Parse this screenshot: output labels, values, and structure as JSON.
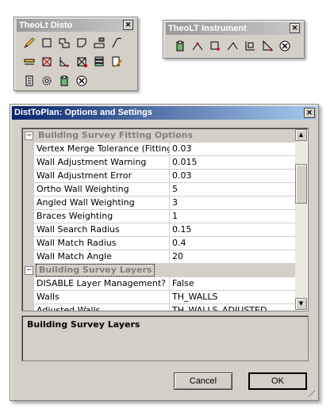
{
  "disto_toolbar": {
    "title": "TheoLt Disto",
    "close_label": "✕",
    "rows": [
      [
        "pencil-icon",
        "rectangle-icon",
        "step-rect-icon",
        "corner-rect-icon",
        "layer-rect-icon",
        "arc-line-icon"
      ],
      [
        "layer-lines-icon",
        "cross-box-icon",
        "measure-tri-icon",
        "cross-box-red-icon",
        "layers-stack-icon",
        "edit-doc-icon"
      ],
      [
        "device-icon",
        "gear-icon",
        "clip-icon",
        "close-circle-icon"
      ]
    ]
  },
  "instrument_toolbar": {
    "title": "TheoLT Instrument",
    "close_label": "✕",
    "icons": [
      "clip-icon",
      "point-arc-icon",
      "box-point-icon",
      "angle-line-icon",
      "corner-measure-icon",
      "triangle-measure-icon",
      "close-circle-icon"
    ]
  },
  "dialog": {
    "title": "DistToPlan: Options and Settings",
    "close_label": "✕",
    "categories": [
      {
        "name": "Building Survey Fitting Options",
        "toggle": "−",
        "rows": [
          {
            "name": "Vertex Merge Tolerance (Fitting)",
            "value": "0.03"
          },
          {
            "name": "Wall Adjustment Warning",
            "value": "0.015"
          },
          {
            "name": "Wall Adjustment Error",
            "value": "0.03"
          },
          {
            "name": "Ortho Wall Weighting",
            "value": "5"
          },
          {
            "name": "Angled Wall Weighting",
            "value": "3"
          },
          {
            "name": "Braces Weighting",
            "value": "1"
          },
          {
            "name": "Wall Search Radius",
            "value": "0.15"
          },
          {
            "name": "Wall Match Radius",
            "value": "0.4"
          },
          {
            "name": "Wall Match Angle",
            "value": "20"
          }
        ]
      },
      {
        "name": "Building Survey Layers",
        "toggle": "−",
        "rows": [
          {
            "name": "DISABLE Layer Management?",
            "value": "False"
          },
          {
            "name": "Walls",
            "value": "TH_WALLS"
          },
          {
            "name": "Adjusted Walls",
            "value": "TH_WALLS_ADJUSTED"
          }
        ]
      }
    ],
    "description": "Building Survey Layers",
    "cancel_label": "Cancel",
    "ok_label": "OK",
    "scroll_up": "▲",
    "scroll_down": "▼"
  }
}
